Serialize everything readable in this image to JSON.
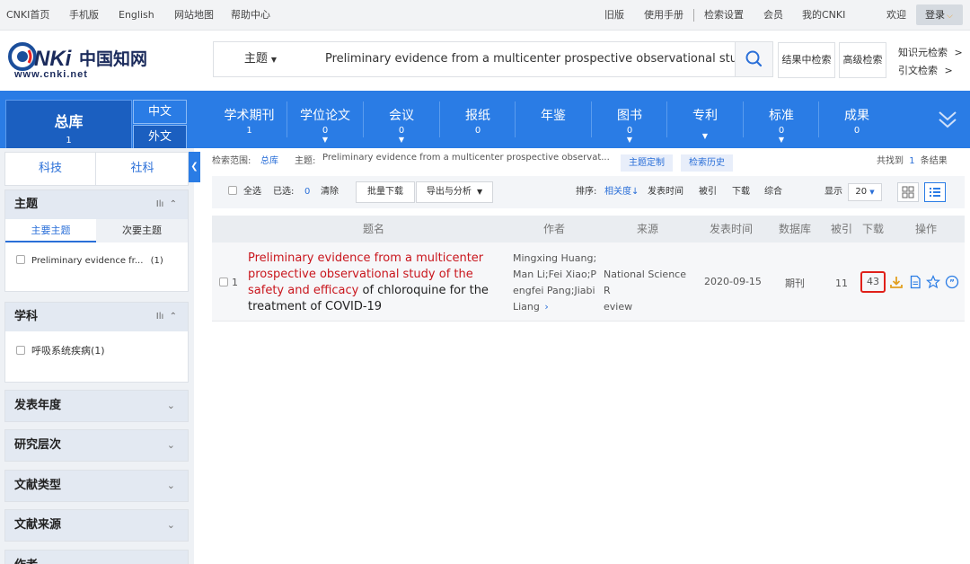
{
  "topbar": {
    "left_links": [
      "CNKI首页",
      "手机版",
      "English",
      "网站地图",
      "帮助中心"
    ],
    "right_links": [
      "旧版",
      "使用手册",
      "检索设置",
      "会员",
      "我的CNKI"
    ],
    "welcome": "欢迎",
    "login": "登录"
  },
  "header": {
    "logo_alt": "CNKI中国知网 www.cnki.net",
    "logo_url": "www.cnki.net",
    "search_field": "主题",
    "search_query": "Preliminary evidence from a multicenter prospective observational study of the safety and efficacy",
    "search_in_results": "结果中检索",
    "advanced_search": "高级检索",
    "knowledge_search": "知识元检索",
    "citation_search": "引文检索",
    "chevron": ">"
  },
  "nav": {
    "total": {
      "label": "总库",
      "count": "1"
    },
    "lang_cn": "中文",
    "lang_foreign": "外文",
    "categories": [
      {
        "label": "学术期刊",
        "count": "1"
      },
      {
        "label": "学位论文",
        "count": "0"
      },
      {
        "label": "会议",
        "count": "0"
      },
      {
        "label": "报纸",
        "count": "0"
      },
      {
        "label": "年鉴",
        "count": ""
      },
      {
        "label": "图书",
        "count": "0"
      },
      {
        "label": "专利",
        "count": ""
      },
      {
        "label": "标准",
        "count": "0"
      },
      {
        "label": "成果",
        "count": "0"
      }
    ]
  },
  "sidebar": {
    "tabs": [
      "科技",
      "社科"
    ],
    "topic": {
      "title": "主题",
      "subtabs": [
        "主要主题",
        "次要主题"
      ],
      "items": [
        {
          "label": "Preliminary evidence fr...",
          "count": "(1)"
        }
      ]
    },
    "discipline": {
      "title": "学科",
      "items": [
        {
          "label": "呼吸系统疾病",
          "count": "(1)"
        }
      ]
    },
    "collapsed": [
      "发表年度",
      "研究层次",
      "文献类型",
      "文献来源",
      "作者"
    ]
  },
  "scope": {
    "label": "检索范围:",
    "value": "总库",
    "topic_label": "主题:",
    "topic_value": "Preliminary evidence from a multicenter prospective observat...",
    "custom_topic": "主题定制",
    "history": "检索历史",
    "found_prefix": "共找到",
    "found_count": "1",
    "found_suffix": "条结果"
  },
  "toolbar": {
    "select_all": "全选",
    "selected_label": "已选:",
    "selected_count": "0",
    "clear": "清除",
    "batch_download": "批量下载",
    "export_analysis": "导出与分析",
    "sort_label": "排序:",
    "sort_options": [
      "相关度",
      "发表时间",
      "被引",
      "下载",
      "综合"
    ],
    "display_label": "显示",
    "page_size": "20"
  },
  "table": {
    "headers": [
      "题名",
      "作者",
      "来源",
      "发表时间",
      "数据库",
      "被引",
      "下载",
      "操作"
    ],
    "rows": [
      {
        "index": "1",
        "title_highlight": "Preliminary evidence from a multicenter prospective observational study of the safety and efficacy",
        "title_rest": " of chloroquine for the treatment of COVID-19",
        "authors": [
          "Mingxing Huang;",
          "Man Li;Fei Xiao;P",
          "engfei Pang;Jiabi",
          "Liang"
        ],
        "source": [
          "National Science R",
          "eview"
        ],
        "date": "2020-09-15",
        "database": "期刊",
        "cited": "11",
        "downloads": "43"
      }
    ]
  }
}
